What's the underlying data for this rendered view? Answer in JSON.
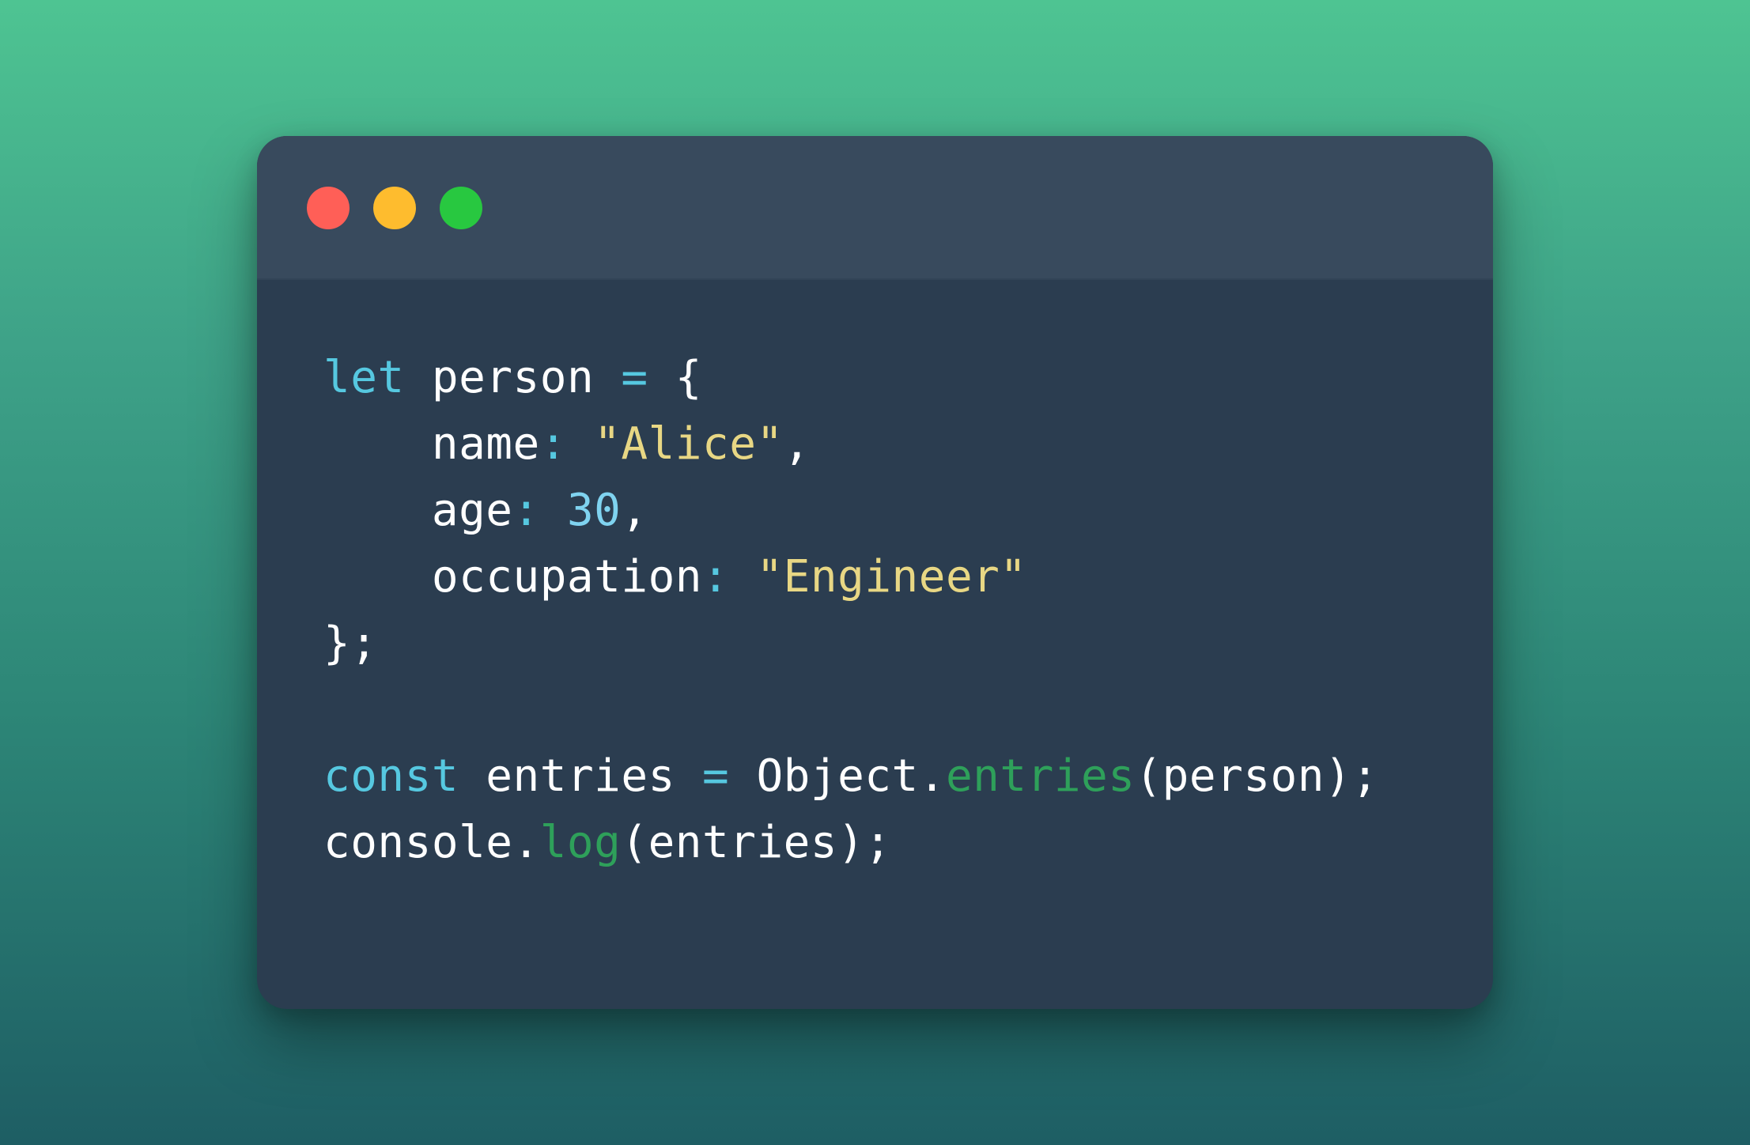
{
  "colors": {
    "window_bg": "#2b3d50",
    "titlebar_bg": "#384a5d",
    "dot_close": "#ff5f57",
    "dot_minimize": "#febc2e",
    "dot_maximize": "#28c840",
    "keyword": "#56c8e0",
    "string": "#e8d784",
    "number": "#7fd3f0",
    "function": "#2ea05a",
    "text": "#ffffff"
  },
  "window_controls": [
    {
      "name": "close",
      "color": "#ff5f57"
    },
    {
      "name": "minimize",
      "color": "#febc2e"
    },
    {
      "name": "maximize",
      "color": "#28c840"
    }
  ],
  "code": {
    "language": "javascript",
    "lines": [
      [
        {
          "text": "let",
          "type": "kw"
        },
        {
          "text": " person ",
          "type": "plain"
        },
        {
          "text": "=",
          "type": "op"
        },
        {
          "text": " {",
          "type": "plain"
        }
      ],
      [
        {
          "text": "    name",
          "type": "plain"
        },
        {
          "text": ":",
          "type": "op"
        },
        {
          "text": " ",
          "type": "plain"
        },
        {
          "text": "\"Alice\"",
          "type": "str"
        },
        {
          "text": ",",
          "type": "plain"
        }
      ],
      [
        {
          "text": "    age",
          "type": "plain"
        },
        {
          "text": ":",
          "type": "op"
        },
        {
          "text": " ",
          "type": "plain"
        },
        {
          "text": "30",
          "type": "num"
        },
        {
          "text": ",",
          "type": "plain"
        }
      ],
      [
        {
          "text": "    occupation",
          "type": "plain"
        },
        {
          "text": ":",
          "type": "op"
        },
        {
          "text": " ",
          "type": "plain"
        },
        {
          "text": "\"Engineer\"",
          "type": "str"
        }
      ],
      [
        {
          "text": "};",
          "type": "plain"
        }
      ],
      [],
      [
        {
          "text": "const",
          "type": "kw"
        },
        {
          "text": " entries ",
          "type": "plain"
        },
        {
          "text": "=",
          "type": "op"
        },
        {
          "text": " Object.",
          "type": "plain"
        },
        {
          "text": "entries",
          "type": "fn"
        },
        {
          "text": "(person);",
          "type": "plain"
        }
      ],
      [
        {
          "text": "console.",
          "type": "plain"
        },
        {
          "text": "log",
          "type": "fn"
        },
        {
          "text": "(entries);",
          "type": "plain"
        }
      ]
    ]
  }
}
